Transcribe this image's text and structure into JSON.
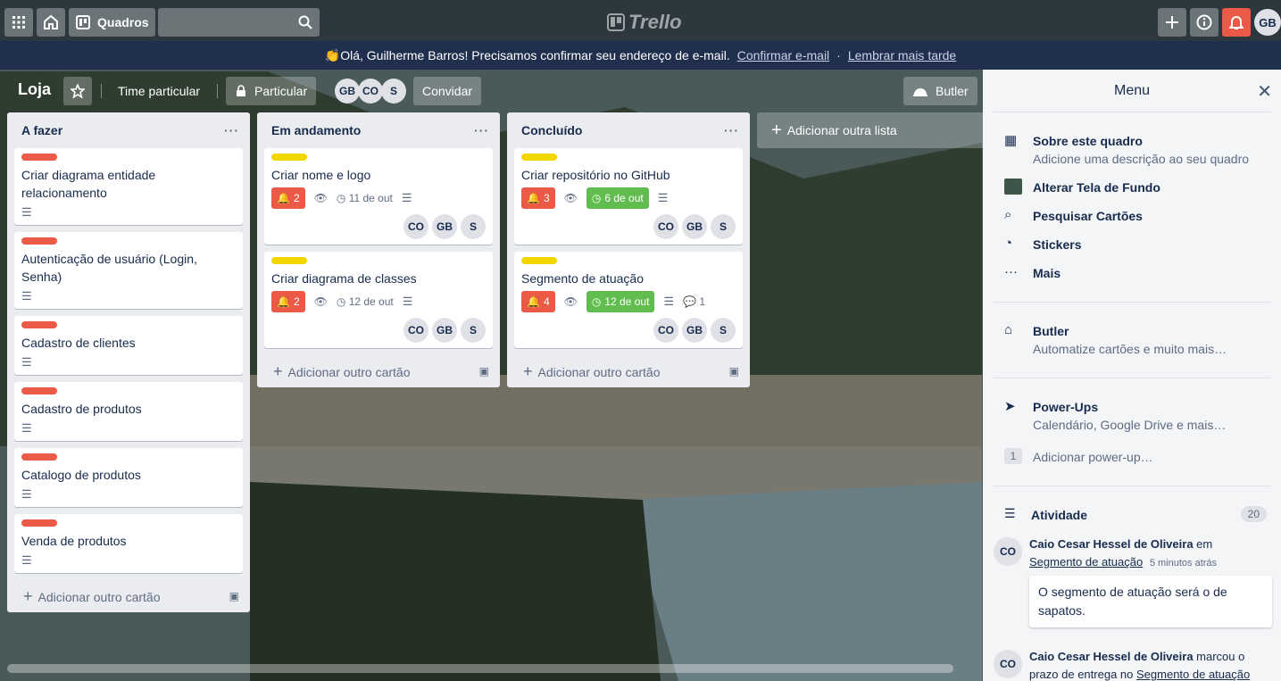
{
  "topbar": {
    "apps_icon": "grid-icon",
    "home_icon": "home-icon",
    "boards_label": "Quadros",
    "logo": "Trello",
    "add_icon": "plus-icon",
    "info_icon": "info-icon",
    "notif_icon": "bell-icon",
    "user_initials": "GB"
  },
  "banner": {
    "text": "👏Olá, Guilherme Barros! Precisamos confirmar seu endereço de e-mail.",
    "confirm": "Confirmar e-mail",
    "separator": "·",
    "later": "Lembrar mais tarde"
  },
  "board": {
    "name": "Loja",
    "team": "Time particular",
    "visibility": "Particular",
    "members": [
      "GB",
      "CO",
      "S"
    ],
    "invite": "Convidar",
    "butler": "Butler",
    "add_list": "Adicionar outra lista"
  },
  "lists": [
    {
      "title": "A fazer",
      "menu": "···",
      "add_card": "Adicionar outro cartão",
      "cards": [
        {
          "title": "Criar diagrama entidade relacionamento"
        },
        {
          "title": "Autenticação de usuário (Login, Senha)"
        },
        {
          "title": "Cadastro de clientes"
        },
        {
          "title": "Cadastro de produtos"
        },
        {
          "title": "Catalogo de produtos"
        },
        {
          "title": "Venda de produtos"
        }
      ]
    },
    {
      "title": "Em andamento",
      "menu": "···",
      "add_card": "Adicionar outro cartão",
      "cards": [
        {
          "title": "Criar nome e logo",
          "notif": "2",
          "due": "11 de out",
          "members": [
            "CO",
            "GB",
            "S"
          ]
        },
        {
          "title": "Criar diagrama de classes",
          "notif": "2",
          "due": "12 de out",
          "members": [
            "CO",
            "GB",
            "S"
          ]
        }
      ]
    },
    {
      "title": "Concluído",
      "menu": "···",
      "add_card": "Adicionar outro cartão",
      "cards": [
        {
          "title": "Criar repositório no GitHub",
          "notif": "3",
          "due": "6 de out",
          "members": [
            "CO",
            "GB",
            "S"
          ]
        },
        {
          "title": "Segmento de atuação",
          "notif": "4",
          "due": "12 de out",
          "comments": "1",
          "members": [
            "CO",
            "GB",
            "S"
          ]
        }
      ]
    }
  ],
  "colors": {
    "label_red": "#eb5a46",
    "label_yellow": "#f2d600",
    "due_green": "#61bd4f",
    "banner_bg": "#1f2f4d"
  },
  "menu": {
    "title": "Menu",
    "about_title": "Sobre este quadro",
    "about_desc": "Adicione uma descrição ao seu quadro",
    "background": "Alterar Tela de Fundo",
    "search": "Pesquisar Cartões",
    "stickers": "Stickers",
    "more": "Mais",
    "butler_title": "Butler",
    "butler_desc": "Automatize cartões e muito mais…",
    "powerups_title": "Power-Ups",
    "powerups_desc": "Calendário, Google Drive e mais…",
    "powerups_count": "1",
    "add_powerup": "Adicionar power-up…",
    "activity_title": "Atividade",
    "activity_count": "20",
    "activity": [
      {
        "initials": "CO",
        "user": "Caio Cesar Hessel de Oliveira",
        "action": "em",
        "card": "Segmento de atuação",
        "time": "5 minutos atrás",
        "comment": "O segmento de atuação será o de sapatos."
      },
      {
        "initials": "CO",
        "user": "Caio Cesar Hessel de Oliveira",
        "action": "marcou o prazo de entrega no",
        "card": "Segmento de atuação"
      }
    ]
  }
}
